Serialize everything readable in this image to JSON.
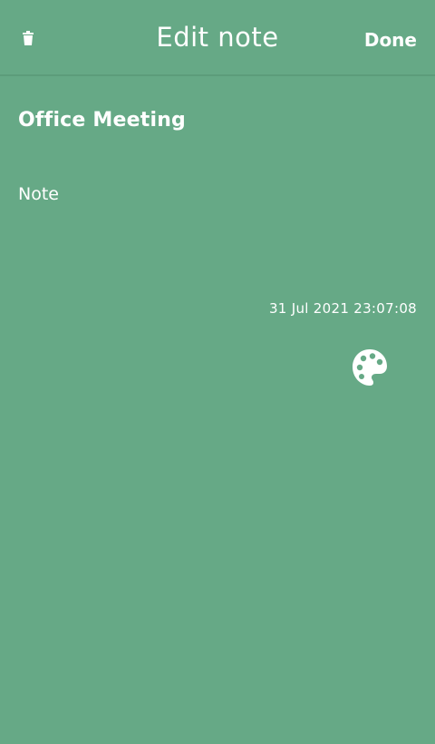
{
  "header": {
    "title": "Edit note",
    "done_label": "Done",
    "delete_icon": "trash-icon"
  },
  "note": {
    "title": "Office Meeting",
    "body": "Note",
    "timestamp": "31 Jul 2021 23:07:08"
  },
  "palette_icon": "palette-icon",
  "colors": {
    "background": "#66a986",
    "text": "#ffffff"
  }
}
